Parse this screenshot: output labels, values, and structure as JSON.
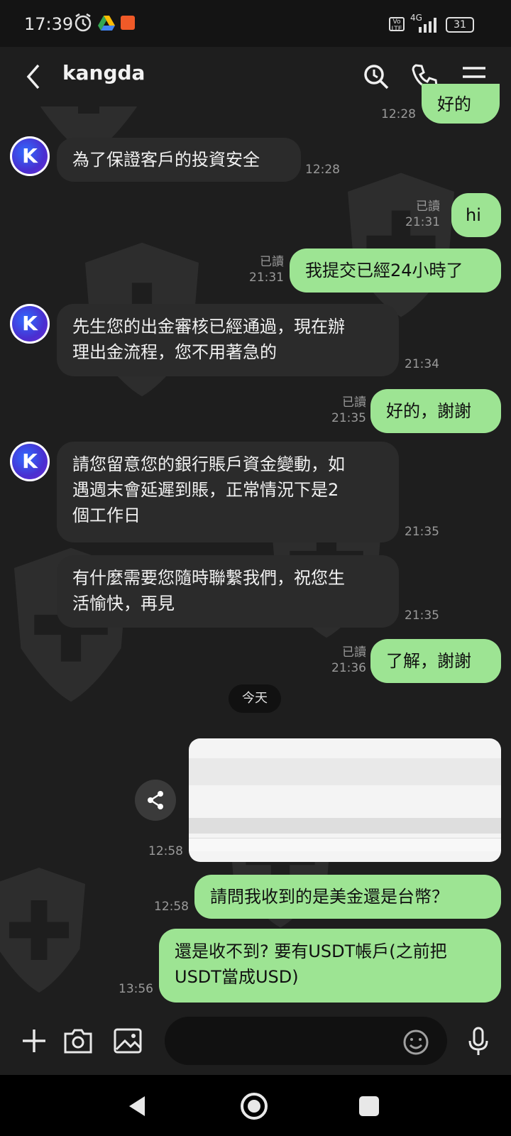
{
  "status_bar": {
    "time": "17:39",
    "icons": [
      "alarm-icon",
      "drive-icon",
      "app-notification-icon",
      "volte-icon",
      "signal-4g-icon",
      "battery-icon"
    ],
    "network": "4G",
    "battery": "31"
  },
  "header": {
    "back_icon": "back-arrow-icon",
    "title": "kangda",
    "actions": [
      "search-icon",
      "phone-icon",
      "menu-icon"
    ]
  },
  "messages": [
    {
      "dir": "in",
      "avatar": "K",
      "text": "為了保證客戶的投資安全",
      "time": "12:28"
    },
    {
      "dir": "out",
      "read": "已讀",
      "text": "hi",
      "time": "21:31"
    },
    {
      "dir": "out",
      "read": "已讀",
      "text": "我提交已經24小時了",
      "time": "21:31"
    },
    {
      "dir": "in",
      "avatar": "K",
      "line1": "先生您的出金審核已經通過，現在辦",
      "line2": "理出金流程，您不用著急的",
      "time": "21:34"
    },
    {
      "dir": "out",
      "read": "已讀",
      "text": "好的，謝謝",
      "time": "21:35"
    },
    {
      "dir": "in",
      "avatar": "K",
      "line1": "請您留意您的銀行賬戶資金變動，如",
      "line2": "遇週末會延遲到賬，正常情況下是2",
      "line3": "個工作日",
      "time": "21:35"
    },
    {
      "dir": "in",
      "line1": "有什麼需要您隨時聯繫我們，祝您生",
      "line2": "活愉快，再見",
      "time": "21:35"
    },
    {
      "dir": "out",
      "read": "已讀",
      "text": "了解，謝謝",
      "time": "21:36"
    },
    {
      "dir": "out",
      "image": true,
      "time": "12:58"
    },
    {
      "dir": "out",
      "text": "請問我收到的是美金還是台幣？",
      "time": "12:58"
    },
    {
      "dir": "out",
      "line1": "還是收不到? 要有USDT帳戶(之前把",
      "line2": "USDT當成USD)",
      "time": "13:56"
    }
  ],
  "top_partial": {
    "time": "12:28",
    "text": "好的"
  },
  "date_divider": "今天",
  "composer": {
    "icons": [
      "plus-icon",
      "camera-icon",
      "image-icon",
      "emoji-icon",
      "microphone-icon"
    ],
    "placeholder": ""
  },
  "nav": [
    "back-triangle-icon",
    "home-circle-icon",
    "recents-square-icon"
  ],
  "colors": {
    "outgoing": "#9de493",
    "incoming": "#2b2b2b",
    "background": "#1e1e1e"
  }
}
